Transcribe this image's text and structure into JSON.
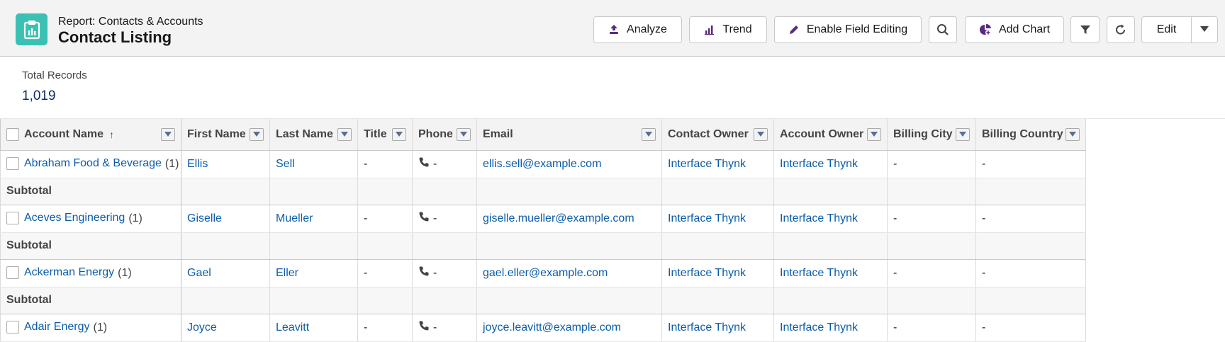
{
  "header": {
    "subtitle": "Report: Contacts & Accounts",
    "title": "Contact Listing",
    "buttons": {
      "analyze": "Analyze",
      "trend": "Trend",
      "enable_field_editing": "Enable Field Editing",
      "add_chart": "Add Chart",
      "edit": "Edit"
    }
  },
  "summary": {
    "label": "Total Records",
    "value": "1,019"
  },
  "table": {
    "columns": [
      "Account Name",
      "First Name",
      "Last Name",
      "Title",
      "Phone",
      "Email",
      "Contact Owner",
      "Account Owner",
      "Billing City",
      "Billing Country"
    ],
    "sort_indicator": "↑",
    "subtotal_label": "Subtotal",
    "rows": [
      {
        "account": "Abraham Food & Beverage",
        "count": "(1)",
        "first": "Ellis",
        "last": "Sell",
        "title": "-",
        "phone": "-",
        "email": "ellis.sell@example.com",
        "contact_owner": "Interface Thynk",
        "account_owner": "Interface Thynk",
        "city": "-",
        "country": "-"
      },
      {
        "account": "Aceves Engineering",
        "count": "(1)",
        "first": "Giselle",
        "last": "Mueller",
        "title": "-",
        "phone": "-",
        "email": "giselle.mueller@example.com",
        "contact_owner": "Interface Thynk",
        "account_owner": "Interface Thynk",
        "city": "-",
        "country": "-"
      },
      {
        "account": "Ackerman Energy",
        "count": "(1)",
        "first": "Gael",
        "last": "Eller",
        "title": "-",
        "phone": "-",
        "email": "gael.eller@example.com",
        "contact_owner": "Interface Thynk",
        "account_owner": "Interface Thynk",
        "city": "-",
        "country": "-"
      },
      {
        "account": "Adair Energy",
        "count": "(1)",
        "first": "Joyce",
        "last": "Leavitt",
        "title": "-",
        "phone": "-",
        "email": "joyce.leavitt@example.com",
        "contact_owner": "Interface Thynk",
        "account_owner": "Interface Thynk",
        "city": "-",
        "country": "-"
      }
    ]
  },
  "colors": {
    "accent": "#0b5cab",
    "app_icon": "#3bc1b4",
    "icon_purple": "#5a2a82"
  },
  "icons": [
    "report-icon",
    "analyze-icon",
    "trend-icon",
    "pencil-icon",
    "search-icon",
    "add-chart-icon",
    "filter-icon",
    "refresh-icon",
    "chevron-down-icon",
    "phone-icon"
  ]
}
